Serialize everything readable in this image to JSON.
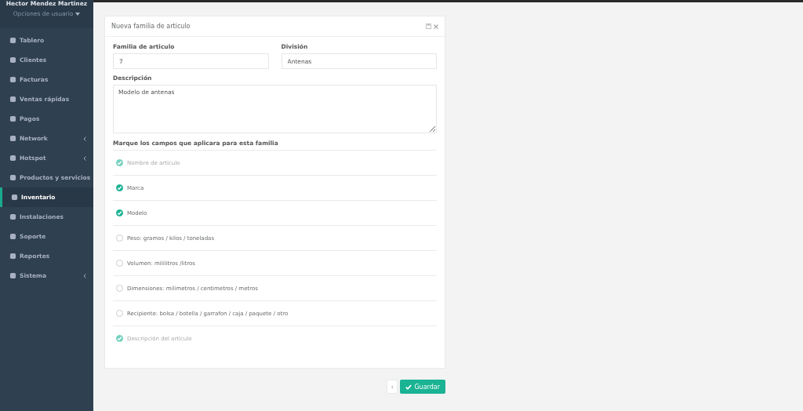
{
  "user": {
    "name": "Hector Mendez Martinez",
    "options": "Opciones de usuario"
  },
  "menu": [
    {
      "label": "Tablero",
      "selected": false,
      "submenu": false
    },
    {
      "label": "Clientes",
      "selected": false,
      "submenu": false
    },
    {
      "label": "Facturas",
      "selected": false,
      "submenu": false
    },
    {
      "label": "Ventas rápidas",
      "selected": false,
      "submenu": false
    },
    {
      "label": "Pagos",
      "selected": false,
      "submenu": false
    },
    {
      "label": "Network",
      "selected": false,
      "submenu": true
    },
    {
      "label": "Hotspot",
      "selected": false,
      "submenu": true
    },
    {
      "label": "Productos y servicios",
      "selected": false,
      "submenu": false
    },
    {
      "label": "Inventario",
      "selected": true,
      "submenu": false
    },
    {
      "label": "Instalaciones",
      "selected": false,
      "submenu": false
    },
    {
      "label": "Soporte",
      "selected": false,
      "submenu": false
    },
    {
      "label": "Reportes",
      "selected": false,
      "submenu": false
    },
    {
      "label": "Sistema",
      "selected": false,
      "submenu": true
    }
  ],
  "panel": {
    "title": "Nueva familia de articulo",
    "fields": [
      {
        "label": "Familia de articulo",
        "value": "7"
      },
      {
        "label": "División",
        "value": "Antenas"
      }
    ],
    "description": {
      "label": "Descripción",
      "value": "Modelo de antenas"
    },
    "fields_heading": "Marque los campos que aplicara para esta familia",
    "options": [
      {
        "label": "Nombre de articulo",
        "checked": true,
        "disabled": true
      },
      {
        "label": "Marca",
        "checked": true,
        "disabled": false
      },
      {
        "label": "Modelo",
        "checked": true,
        "disabled": false
      },
      {
        "label": "Peso: gramos / kilos / toneladas",
        "checked": false,
        "disabled": false
      },
      {
        "label": "Volumen: mililitros /litros",
        "checked": false,
        "disabled": false
      },
      {
        "label": "Dimensiones: milimetros / centimetros / metros",
        "checked": false,
        "disabled": false
      },
      {
        "label": "Recipiente: bolsa / botella / garrafon / caja / paquete / otro",
        "checked": false,
        "disabled": false
      },
      {
        "label": "Descripción del artículo",
        "checked": true,
        "disabled": true
      }
    ]
  },
  "buttons": {
    "back": "‹",
    "save": "Guardar"
  }
}
